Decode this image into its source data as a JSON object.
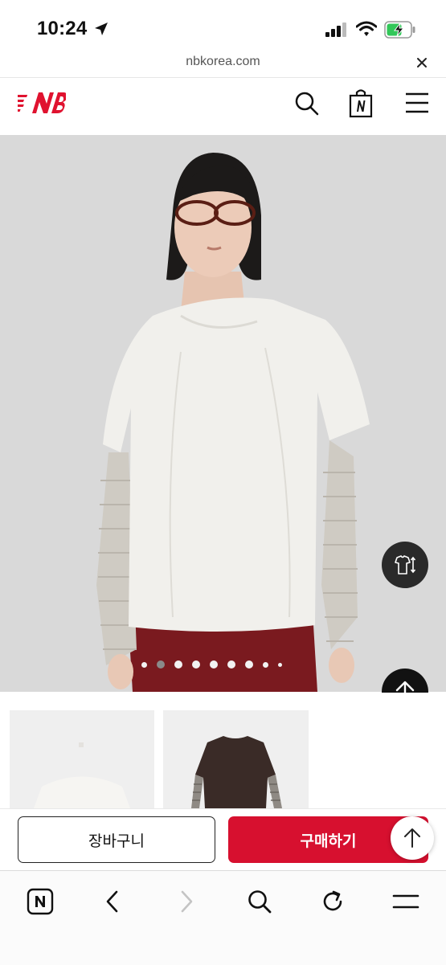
{
  "status_bar": {
    "time": "10:24"
  },
  "browser": {
    "url": "nbkorea.com"
  },
  "header": {
    "logo": "NB"
  },
  "hero": {
    "slide_count": 9,
    "active_slide": 2
  },
  "actions": {
    "cart_label": "장바구니",
    "buy_label": "구매하기"
  },
  "colors": {
    "brand_red": "#d7102f",
    "hero_bg": "#d9d9d9",
    "fab_bg": "#121212"
  }
}
